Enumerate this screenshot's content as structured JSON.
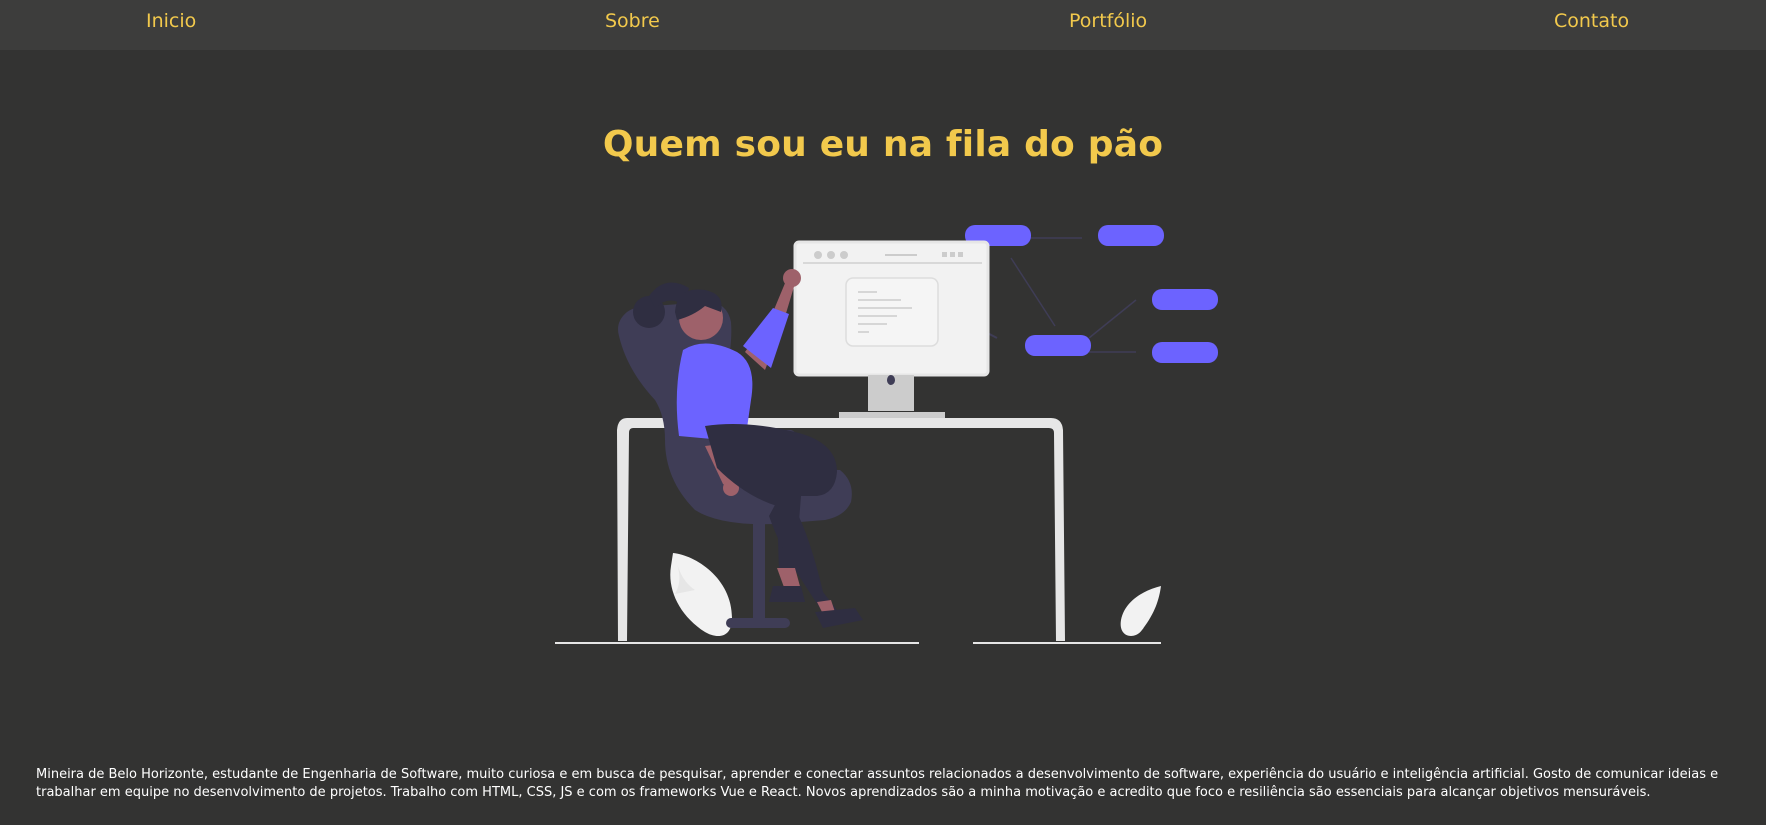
{
  "nav": {
    "items": [
      {
        "label": "Inicio"
      },
      {
        "label": "Sobre"
      },
      {
        "label": "Portfólio"
      },
      {
        "label": "Contato"
      }
    ]
  },
  "hero": {
    "title": "Quem sou eu na fila do pão",
    "illustration_icon": "woman-at-desk-illustration"
  },
  "about": {
    "text": "Mineira de Belo Horizonte, estudante de Engenharia de Software, muito curiosa e em busca de pesquisar, aprender e conectar assuntos relacionados a desenvolvimento de software, experiência do usuário e inteligência artificial. Gosto de comunicar ideias e trabalhar em equipe no desenvolvimento de projetos. Trabalho com HTML, CSS, JS e com os frameworks Vue e React. Novos aprendizados são a minha motivação e acredito que foco e resiliência são essenciais para alcançar objetivos mensuráveis."
  },
  "colors": {
    "background": "#333332",
    "navbar": "#3d3d3c",
    "accent": "#f2c94c",
    "illustration_primary": "#6c63ff",
    "chair": "#3f3d56",
    "text": "#ffffff"
  }
}
